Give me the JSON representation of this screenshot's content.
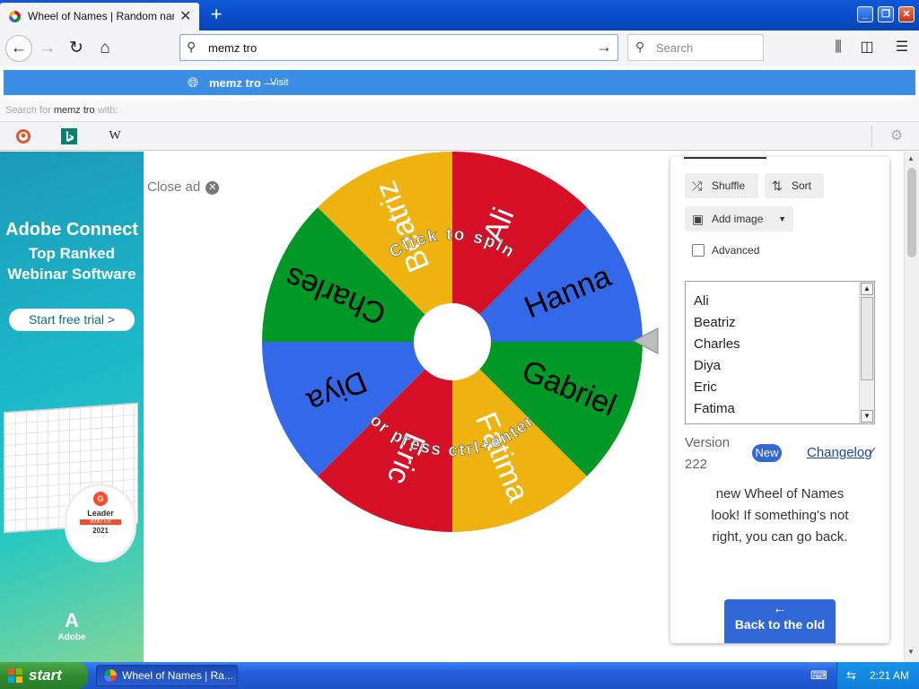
{
  "browser": {
    "tab_title": "Wheel of Names | Random name p",
    "address_value": "memz tro",
    "search_placeholder": "Search"
  },
  "suggestion": {
    "text": "memz tro",
    "separator": "—",
    "action": "Visit",
    "search_with_prefix": "Search for",
    "search_with_term": "memz tro",
    "search_with_suffix": "with:"
  },
  "engines": [
    "duckduckgo-icon",
    "bing-icon",
    "wikipedia-icon"
  ],
  "ad": {
    "title": "Adobe Connect",
    "subtitle_1": "Top Ranked",
    "subtitle_2": "Webinar Software",
    "cta": "Start free trial >",
    "badge_brand": "G",
    "badge_label": "Leader",
    "badge_season": "WINTER",
    "badge_year": "2021",
    "logo_text": "Adobe"
  },
  "close_ad": {
    "label": "Close ad",
    "icon": "close-circle-icon"
  },
  "wheel": {
    "names_order": [
      "Ali",
      "Hanna",
      "Gabriel",
      "Fatima",
      "Eric",
      "Diya",
      "Charles",
      "Beatriz"
    ],
    "segment_colors": [
      "#3369e8",
      "#009925",
      "#eeb211",
      "#d50f25",
      "#3369e8",
      "#009925",
      "#eeb211",
      "#d50f25"
    ],
    "prompt_top": "Click to spin",
    "prompt_bottom": "or press ctrl+enter"
  },
  "panel": {
    "shuffle": "Shuffle",
    "sort": "Sort",
    "add_image": "Add image",
    "advanced": "Advanced",
    "entries": [
      "Ali",
      "Beatriz",
      "Charles",
      "Diya",
      "Eric",
      "Fatima"
    ],
    "version_label": "Version",
    "version_number": "222",
    "new_badge": "New",
    "changelog": "Changelog",
    "notice": "new Wheel of Names look! If something's not right, you can go back.",
    "back_button": "Back to the old"
  },
  "taskbar": {
    "start": "start",
    "app": "Wheel of Names | Ra...",
    "clock": "2:21 AM"
  }
}
